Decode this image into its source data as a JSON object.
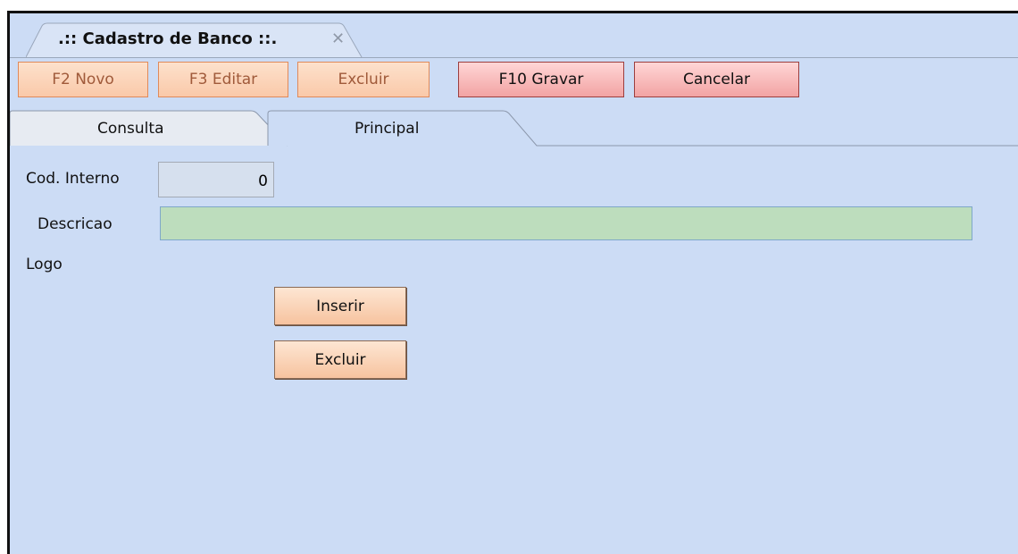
{
  "window": {
    "tab_title": ".:: Cadastro de Banco ::.",
    "close_glyph": "✕"
  },
  "toolbar": {
    "novo_label": "F2 Novo",
    "editar_label": "F3 Editar",
    "excluir_label": "Excluir",
    "gravar_label": "F10 Gravar",
    "cancelar_label": "Cancelar"
  },
  "tabs": [
    {
      "label": "Consulta",
      "selected": false
    },
    {
      "label": "Principal",
      "selected": true
    }
  ],
  "form": {
    "cod_interno_label": "Cod. Interno",
    "cod_interno_value": "0",
    "descricao_label": "Descricao",
    "descricao_value": "",
    "logo_label": "Logo",
    "inserir_label": "Inserir",
    "excluir_label": "Excluir"
  },
  "colors": {
    "background": "#ccdcf5",
    "disabled_button": "#fac9a9",
    "active_button": "#f2a3a3",
    "description_field": "#bdddbd"
  }
}
